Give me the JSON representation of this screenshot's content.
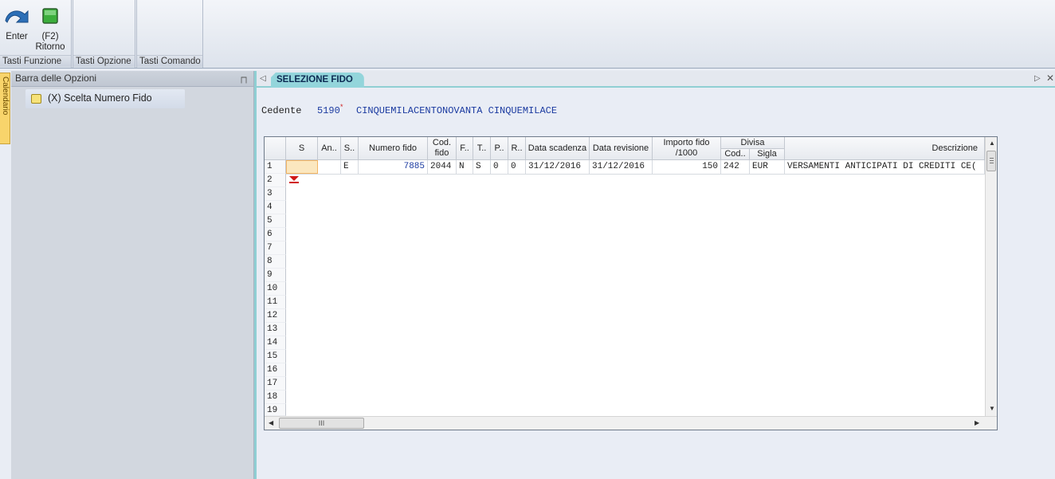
{
  "ribbon": {
    "buttons": [
      {
        "label": "Enter",
        "icon": "enter-arrow-icon"
      },
      {
        "label": "(F2)\nRitorno",
        "icon": "green-square-icon"
      }
    ],
    "groups": [
      "Tasti Funzione",
      "Tasti Opzione",
      "Tasti Comando"
    ]
  },
  "side_tab": "Calendario",
  "left_pane": {
    "title": "Barra delle Opzioni",
    "item": "(X) Scelta Numero Fido"
  },
  "main": {
    "tab": "SELEZIONE FIDO",
    "cedente_label": "Cedente",
    "cedente_code": "5190",
    "cedente_marker": "*",
    "cedente_name": "CINQUEMILACENTONOVANTA CINQUEMILACE"
  },
  "grid": {
    "headers": {
      "s": "S",
      "an": "An..",
      "s2": "S..",
      "numero_fido": "Numero fido",
      "cod_fido": "Cod.\nfido",
      "f": "F..",
      "t": "T..",
      "p": "P..",
      "r": "R..",
      "data_scadenza": "Data scadenza",
      "data_revisione": "Data revisione",
      "importo": "Importo fido\n/1000",
      "divisa": "Divisa",
      "divisa_cod": "Cod..",
      "divisa_sigla": "Sigla",
      "descrizione": "Descrizione"
    },
    "row1": {
      "s2": "E",
      "numero_fido": "7885",
      "cod_fido": "2044",
      "f": "N",
      "t": "S",
      "p": "0",
      "r": "0",
      "data_scadenza": "31/12/2016",
      "data_revisione": "31/12/2016",
      "importo": "150",
      "divisa_cod": "242",
      "divisa_sigla": "EUR",
      "descrizione": "VERSAMENTI ANTICIPATI DI CREDITI CE("
    },
    "row_numbers": [
      "1",
      "2",
      "3",
      "4",
      "5",
      "6",
      "7",
      "8",
      "9",
      "10",
      "11",
      "12",
      "13",
      "14",
      "15",
      "16",
      "17",
      "18",
      "19"
    ],
    "hscroll_thumb": "III"
  }
}
